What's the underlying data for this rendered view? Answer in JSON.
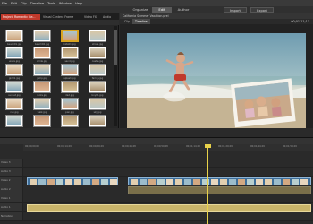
{
  "menubar": {
    "items": [
      "File",
      "Edit",
      "Clip",
      "Timeline",
      "Tools",
      "Window",
      "Help"
    ]
  },
  "topnav": {
    "tabs": [
      "Organize",
      "Edit",
      "Author"
    ],
    "active_tab": "Edit",
    "buttons": [
      "Import",
      "Export"
    ]
  },
  "project_panel": {
    "tabs": [
      "Project: Romantic Ge...",
      "Visual Content Frame",
      "Video FX",
      "Audio"
    ],
    "thumbnails": [
      "beach01.jpg",
      "beach02.jpg",
      "kids01.jpg",
      "shore.jpg",
      "wave.jpg",
      "smile.jpg",
      "sand.jpg",
      "castle.jpg",
      "girl01.jpg",
      "jump.jpg",
      "splash.jpg",
      "family.jpg",
      "sunset.jpg",
      "rocks.jpg",
      "dad.jpg",
      "boy01.jpg",
      "run.jpg",
      "walk.jpg",
      "pier.jpg",
      "sky.jpg",
      "shell.jpg",
      "hat.jpg",
      "hug.jpg",
      "play.jpg"
    ]
  },
  "monitor": {
    "title": "California Summer Vacation.prel",
    "tabs": [
      "Clip",
      "Timeline"
    ],
    "active_tab": "Timeline",
    "timecode": "00;01;11;11"
  },
  "timeline": {
    "ruler": [
      "00;00;00;00",
      "00;00;14;29",
      "00;00;29;29",
      "00;00;44;28",
      "00;00;59;28",
      "00;01;14;28",
      "00;01;29;29",
      "00;01;44;29",
      "00;01;59;29"
    ],
    "tracks": [
      "Video 3",
      "Audio 3",
      "Video 2",
      "Audio 2",
      "Video 1",
      "Audio 1",
      "Narration",
      "Soundtrack"
    ]
  },
  "colors": {
    "accent": "#c0392b",
    "clip_video": "#3f6f9a",
    "clip_audio": "#c9b46a",
    "playhead": "#e8d24a"
  }
}
